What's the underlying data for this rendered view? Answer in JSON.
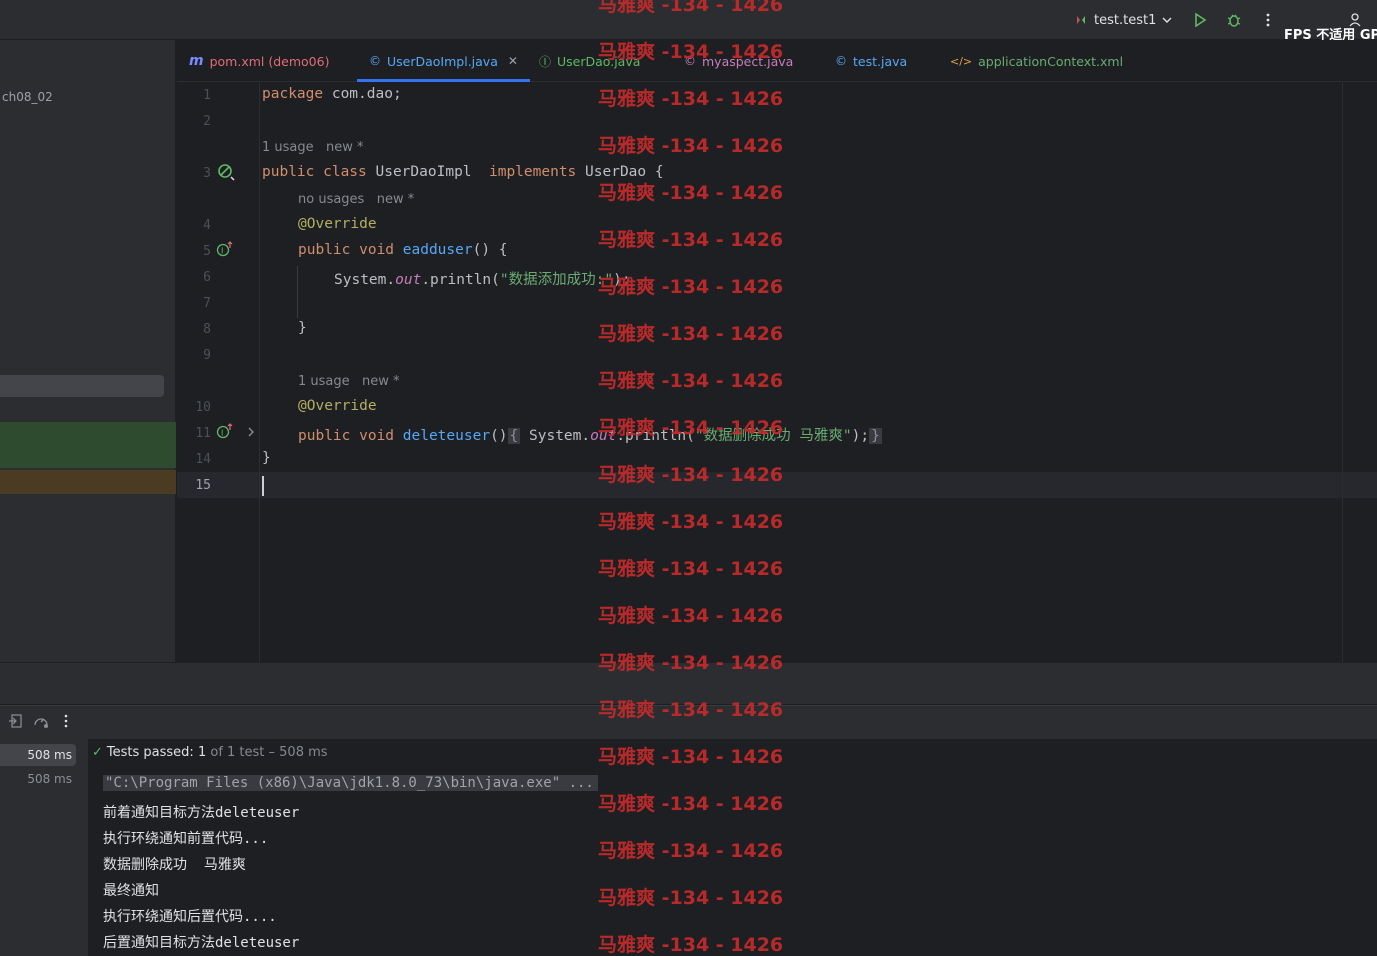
{
  "titlebar": {
    "run_config": "test.test1",
    "fps_text": "FPS 不适用 GP"
  },
  "project": {
    "label": "ch08_02"
  },
  "tabs": [
    {
      "label": "pom.xml (demo06)",
      "icon": "m",
      "color": "#e06c75"
    },
    {
      "label": "UserDaoImpl.java",
      "icon": "©",
      "color": "#56a8f5",
      "active": true
    },
    {
      "label": "UserDao.java",
      "icon": "Ⓘ",
      "color": "#5fb865"
    },
    {
      "label": "myaspect.java",
      "icon": "©",
      "color": "#c77dbb"
    },
    {
      "label": "test.java",
      "icon": "©",
      "color": "#56a8f5"
    },
    {
      "label": "applicationContext.xml",
      "icon": "</>",
      "color": "#6aab73"
    }
  ],
  "editor": {
    "line_numbers": [
      "1",
      "2",
      "3",
      "4",
      "5",
      "6",
      "7",
      "8",
      "9",
      "10",
      "11",
      "14",
      "15"
    ],
    "hints": {
      "class_usage": "1 usage   new *",
      "eadduser_usage": "no usages   new *",
      "deleteuser_usage": "1 usage   new *"
    },
    "code": {
      "l1_kw": "package",
      "l1_rest": " com.dao;",
      "l3_kw1": "public class",
      "l3_name": " UserDaoImpl  ",
      "l3_kw2": "implements",
      "l3_rest": " UserDao {",
      "l4": "@Override",
      "l5_kw": "public void",
      "l5_fn": "eadduser",
      "l5_rest": "() {",
      "l6_a": "System.",
      "l6_out": "out",
      "l6_b": ".println(",
      "l6_str": "\"数据添加成功:\"",
      "l6_c": ");",
      "l8": "}",
      "l10": "@Override",
      "l11_kw": "public void",
      "l11_fn": "deleteuser",
      "l11_paren": "()",
      "l11_fold_open": "{",
      "l11_sys": " System.",
      "l11_out": "out",
      "l11_println": ".println(",
      "l11_str": "\"数据删除成功 马雅爽\"",
      "l11_close": ");",
      "l11_fold_close": "}",
      "l14": "}"
    }
  },
  "run": {
    "time_selected": "508 ms",
    "time_second": "508 ms",
    "status_prefix": "Tests passed: ",
    "status_count": "1",
    "status_rest": " of 1 test – 508 ms",
    "output": [
      "\"C:\\Program Files (x86)\\Java\\jdk1.8.0_73\\bin\\java.exe\" ...",
      "前着通知目标方法deleteuser",
      "执行环绕通知前置代码...",
      "数据删除成功  马雅爽",
      "最终通知",
      "执行环绕通知后置代码....",
      "后置通知目标方法deleteuser"
    ]
  },
  "watermark": "马雅爽 -134 - 1426",
  "colors": {
    "accent": "#3574f0",
    "watermark": "#c62b2b",
    "pass": "#5fb865"
  }
}
